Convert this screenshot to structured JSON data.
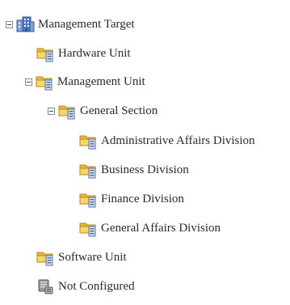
{
  "tree": {
    "root": {
      "label": "Management Target",
      "icon": "building-icon",
      "expanded": true
    },
    "hardware_unit": {
      "label": "Hardware Unit",
      "icon": "folder-server-icon"
    },
    "management_unit": {
      "label": "Management Unit",
      "icon": "folder-server-icon",
      "expanded": true
    },
    "general_section": {
      "label": "General Section",
      "icon": "folder-server-icon",
      "expanded": true
    },
    "admin_division": {
      "label": "Administrative Affairs Division",
      "icon": "folder-server-icon"
    },
    "business_division": {
      "label": "Business Division",
      "icon": "folder-server-icon"
    },
    "finance_division": {
      "label": "Finance Division",
      "icon": "folder-server-icon"
    },
    "general_affairs_division": {
      "label": "General Affairs Division",
      "icon": "folder-server-icon"
    },
    "software_unit": {
      "label": "Software Unit",
      "icon": "folder-server-icon"
    },
    "not_configured": {
      "label": "Not Configured",
      "icon": "gray-server-icon"
    }
  },
  "colors": {
    "folder": "#f0c84a",
    "folder_dark": "#c99a22",
    "server": "#5a7fb8",
    "building": "#4a78c4",
    "gray": "#8a8a8a"
  }
}
